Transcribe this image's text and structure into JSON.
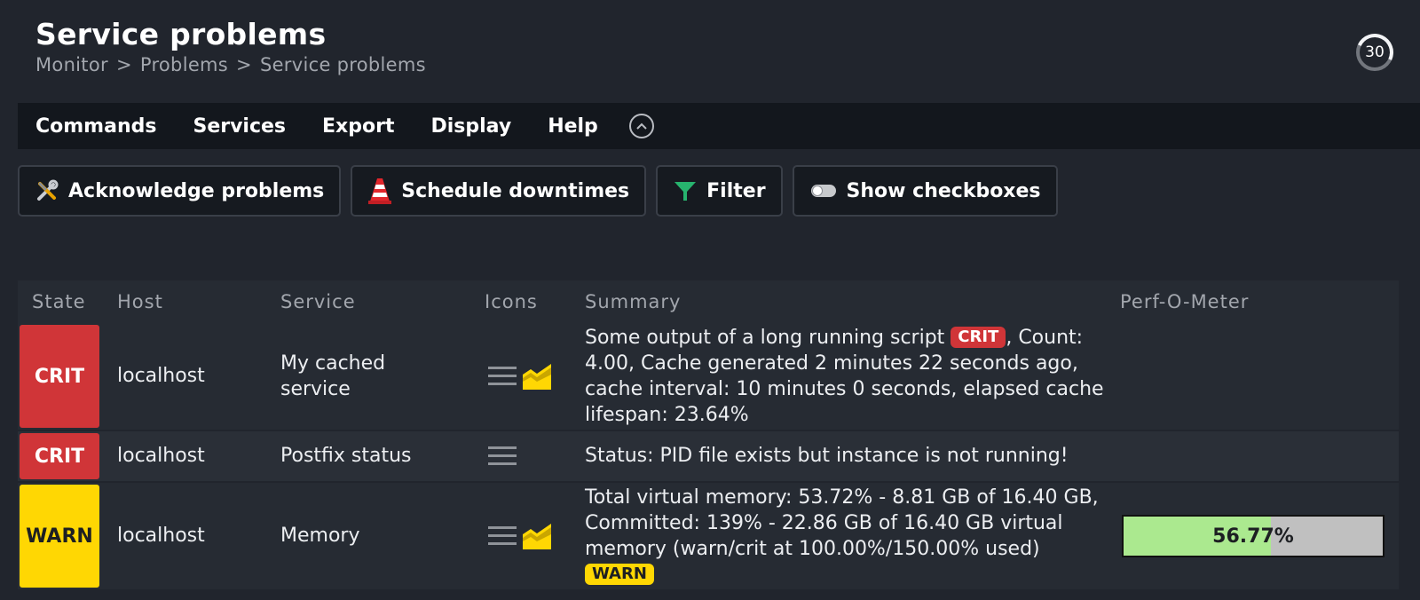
{
  "page": {
    "title": "Service problems",
    "breadcrumb": [
      "Monitor",
      "Problems",
      "Service problems"
    ],
    "refresh_seconds": "30"
  },
  "menubar": {
    "items": [
      "Commands",
      "Services",
      "Export",
      "Display",
      "Help"
    ]
  },
  "toolbar": {
    "acknowledge": "Acknowledge problems",
    "downtimes": "Schedule downtimes",
    "filter": "Filter",
    "checkboxes": "Show checkboxes"
  },
  "table": {
    "headers": [
      "State",
      "Host",
      "Service",
      "Icons",
      "Summary",
      "Perf-O-Meter"
    ],
    "rows": [
      {
        "state": "CRIT",
        "state_color": "#d03538",
        "host": "localhost",
        "service": "My cached service",
        "icons": [
          "menu-icon",
          "graph-icon"
        ],
        "summary_pre": "Some output of a long running script",
        "summary_badge": "CRIT",
        "summary_post": ", Count: 4.00, Cache generated 2 minutes 22 seconds ago, cache interval: 10 minutes 0 seconds, elapsed cache lifespan: 23.64%",
        "perf": ""
      },
      {
        "state": "CRIT",
        "state_color": "#d03538",
        "host": "localhost",
        "service": "Postfix status",
        "icons": [
          "menu-icon"
        ],
        "summary": "Status: PID file exists but instance is not running!",
        "perf": ""
      },
      {
        "state": "WARN",
        "state_color": "#ffd703",
        "host": "localhost",
        "service": "Memory",
        "icons": [
          "menu-icon",
          "graph-icon"
        ],
        "summary_pre": "Total virtual memory: 53.72% - 8.81 GB of 16.40 GB, Committed: 139% - 22.86 GB of 16.40 GB virtual memory (warn/crit at 100.00%/150.00% used)",
        "summary_badge": "WARN",
        "perf_label": "56.77%",
        "perf_value": 56.77
      }
    ]
  },
  "colors": {
    "crit": "#d03538",
    "warn": "#ffd703",
    "perf_fill": "#abe98f"
  }
}
